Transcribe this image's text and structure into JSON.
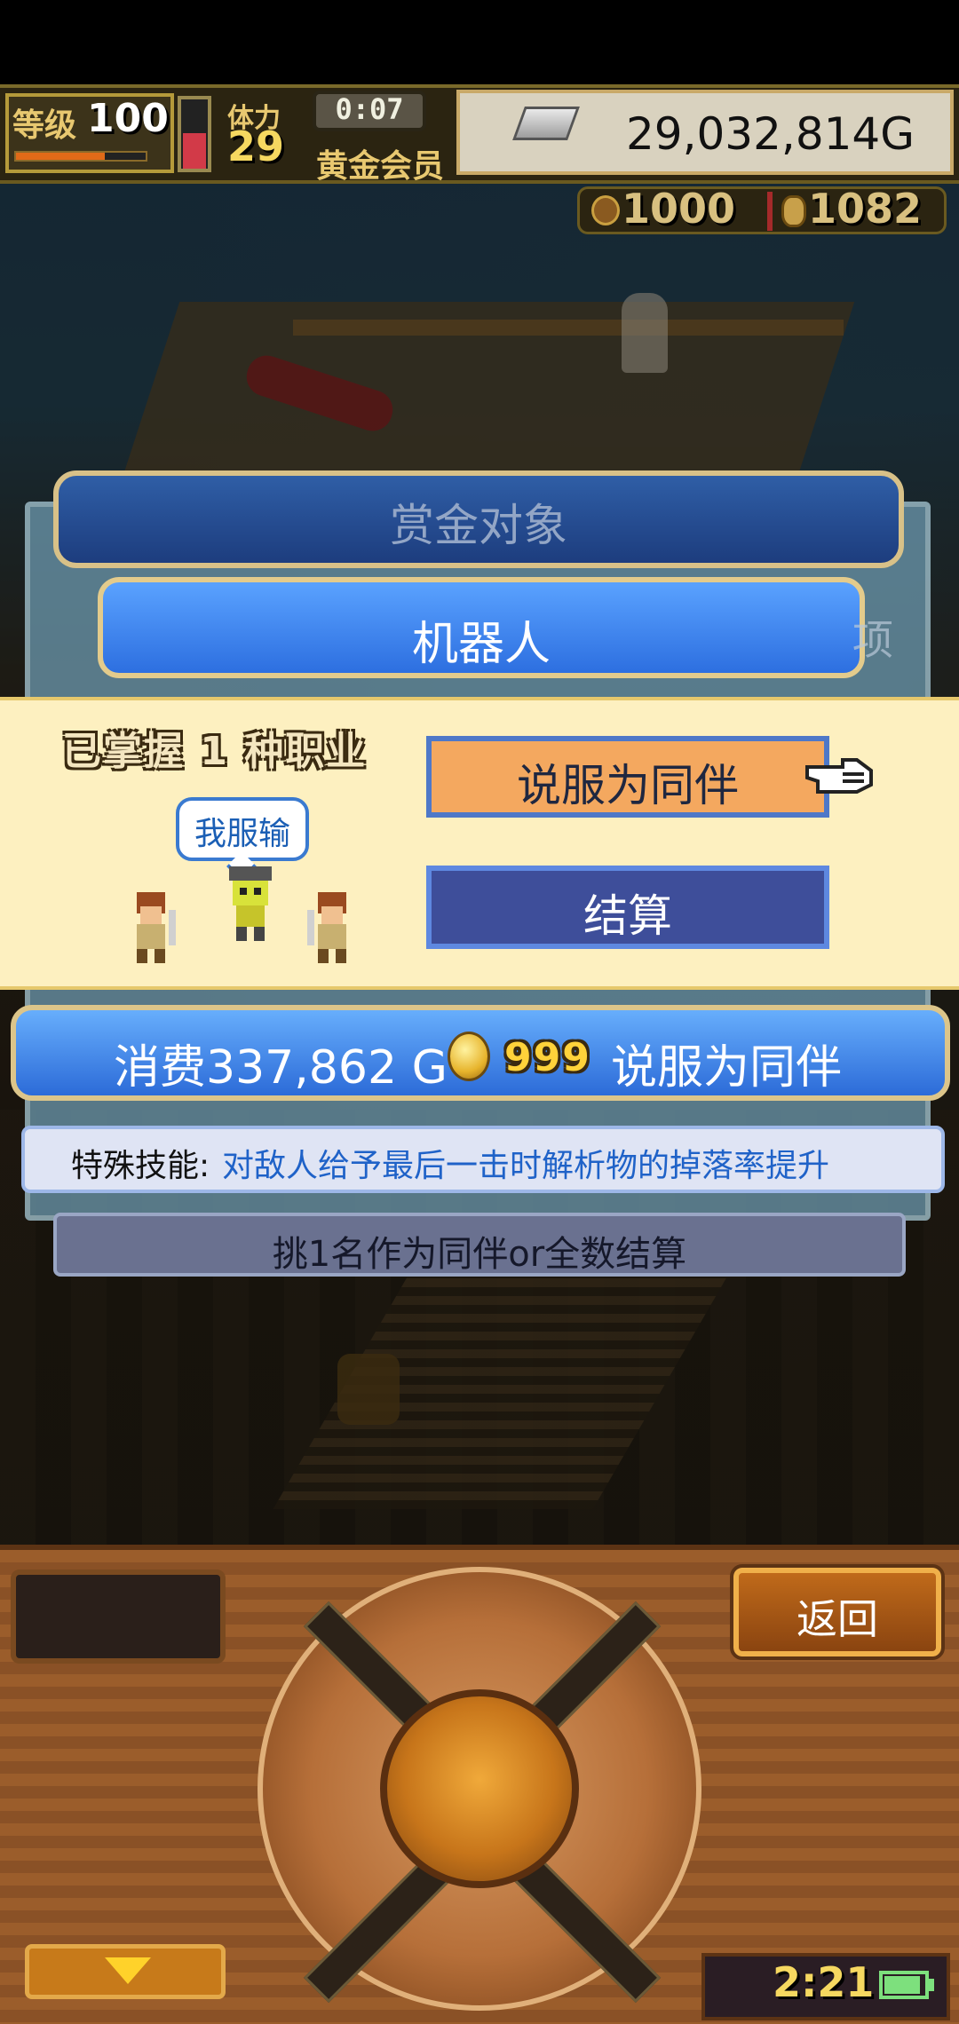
{
  "hud": {
    "level_label": "等级",
    "level_value": "100",
    "stamina_label": "体力",
    "stamina_value": "29",
    "timer": "0:07",
    "membership": "黄金会员",
    "money": "29,032,814G",
    "resource_1": "1000",
    "resource_2": "1082"
  },
  "dialog": {
    "title": "赏金对象",
    "target": "机器人",
    "side_hint": "项",
    "mastered_label": "已掌握 1 种职业",
    "speech_bubble": "我服输",
    "persuade_button": "说服为同伴",
    "settle_button": "结算",
    "cost_text": "消费337,862 G",
    "coin_count": "999",
    "cost_action": "说服为同伴",
    "skill_label": "特殊技能:",
    "skill_text": "对敌人给予最后一击时解析物的掉落率提升",
    "instruction": "挑1名作为同伴or全数结算"
  },
  "controls": {
    "back_button": "返回",
    "clock": "2:21"
  },
  "colors": {
    "banner_blue": "#2d6fe0",
    "persuade_orange": "#f4a85f",
    "settle_blue": "#3e4e9a",
    "skill_text_blue": "#1f62c8",
    "panel_cream": "#fdf0c0",
    "wood": "#9b5d2b",
    "battery_green": "#7de07d"
  }
}
